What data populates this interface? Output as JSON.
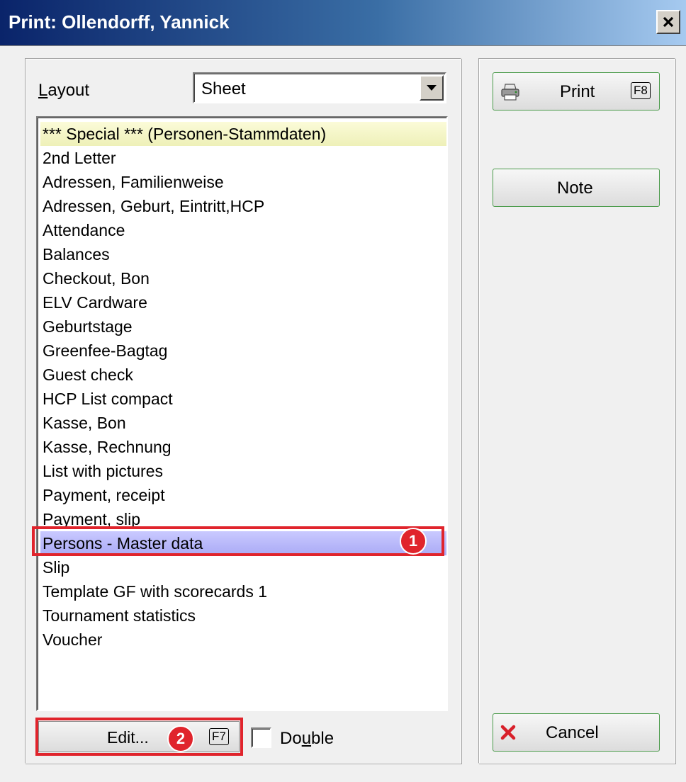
{
  "window": {
    "title": "Print: Ollendorff, Yannick",
    "close_label": "x"
  },
  "layout": {
    "label_prefix": "",
    "label_mnemonic": "L",
    "label_rest": "ayout",
    "selected_value": "Sheet"
  },
  "list": {
    "items": [
      "*** Special *** (Personen-Stammdaten)",
      "2nd Letter",
      "Adressen, Familienweise",
      "Adressen, Geburt, Eintritt,HCP",
      "Attendance",
      "Balances",
      "Checkout, Bon",
      "ELV Cardware",
      "Geburtstage",
      "Greenfee-Bagtag",
      "Guest check",
      "HCP List compact",
      "Kasse, Bon",
      "Kasse, Rechnung",
      "List with pictures",
      "Payment, receipt",
      "Payment, slip",
      "Persons - Master data",
      "Slip",
      "Template GF with scorecards 1",
      "Tournament statistics",
      "Voucher"
    ],
    "selected_item": "Persons - Master data"
  },
  "annotations": {
    "badge_1": "1",
    "badge_2": "2",
    "highlight_color": "#e0242c"
  },
  "buttons": {
    "edit_label": "Edit...",
    "edit_key": "F7",
    "print_label": "Print",
    "print_key": "F8",
    "note_label": "Note",
    "cancel_label": "Cancel"
  },
  "checkbox": {
    "label_prefix": "Do",
    "label_mnemonic": "u",
    "label_rest": "ble",
    "checked": false
  },
  "colors": {
    "title_gradient_start": "#0a246a",
    "title_gradient_end": "#a6caf0",
    "selection": "#aaaaf5",
    "special_row": "#eef0b8",
    "button_border": "#4a9a4a"
  },
  "icons": {
    "print": "printer-icon",
    "cancel": "red-x-icon",
    "dropdown": "triangle-down-icon"
  }
}
